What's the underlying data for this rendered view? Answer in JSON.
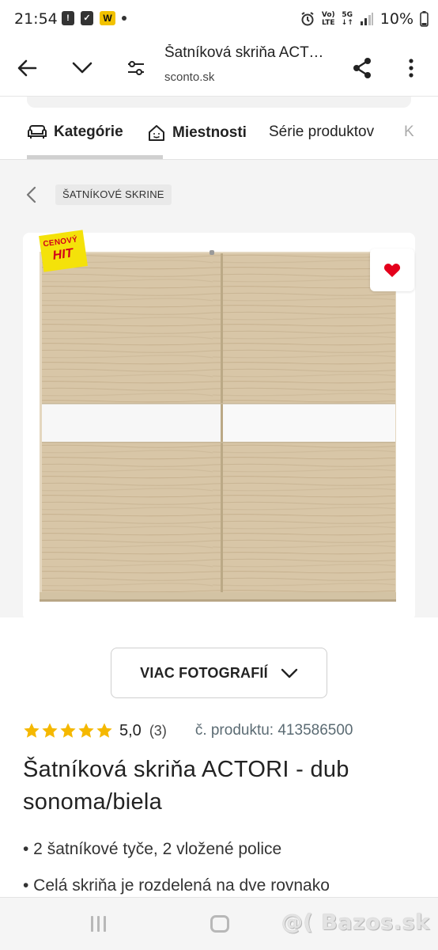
{
  "status_bar": {
    "time": "21:54",
    "battery": "10%",
    "network_top": "Vo)",
    "network_bottom": "LTE",
    "gen": "5G",
    "w_badge": "W"
  },
  "browser": {
    "page_title": "Šatníková skriňa ACTORI - dub sonoma/biela",
    "url": "sconto.sk"
  },
  "category_tabs": [
    {
      "label": "Kategórie",
      "icon": "sofa-icon"
    },
    {
      "label": "Miestnosti",
      "icon": "house-icon"
    },
    {
      "label": "Série produktov"
    },
    {
      "label": "K"
    }
  ],
  "breadcrumb": {
    "label": "ŠATNÍKOVÉ SKRINE"
  },
  "product_image": {
    "badge_line1": "CENOVÝ",
    "badge_line2": "HIT",
    "favorite_icon": "heart-icon",
    "colors": {
      "wood": "#d6c3a4",
      "panel": "#ffffff",
      "heart": "#e4001b"
    }
  },
  "more_photos": {
    "label": "VIAC FOTOGRAFIÍ"
  },
  "rating": {
    "stars": 5,
    "max_stars": 5,
    "value": "5,0",
    "count": "(3)",
    "star_color": "#f5b800"
  },
  "product_code": "č. produktu: 413586500",
  "product": {
    "title": "Šatníková skriňa ACTORI - dub sonoma/biela",
    "bullets": [
      "• 2 šatníkové tyče, 2 vložené police",
      "• Celá skriňa je rozdelená na dve rovnako"
    ]
  },
  "watermark": "@( Bazos.sk"
}
